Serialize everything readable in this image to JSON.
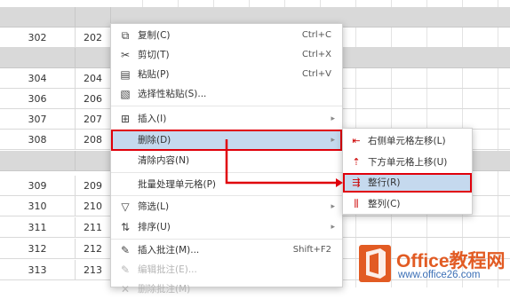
{
  "sheet": {
    "rows": [
      {
        "a": "",
        "b": "",
        "gray": true
      },
      {
        "a": "302",
        "b": "202",
        "gray": false
      },
      {
        "a": "",
        "b": "",
        "gray": true
      },
      {
        "a": "304",
        "b": "204",
        "gray": false
      },
      {
        "a": "306",
        "b": "206",
        "gray": false
      },
      {
        "a": "307",
        "b": "207",
        "gray": false
      },
      {
        "a": "308",
        "b": "208",
        "gray": false
      },
      {
        "a": "",
        "b": "",
        "gray": true
      },
      {
        "a": "309",
        "b": "209",
        "gray": false
      },
      {
        "a": "310",
        "b": "210",
        "gray": false
      },
      {
        "a": "311",
        "b": "211",
        "gray": false
      },
      {
        "a": "312",
        "b": "212",
        "gray": false
      },
      {
        "a": "313",
        "b": "213",
        "gray": false
      }
    ]
  },
  "context_menu": {
    "items": [
      {
        "label": "复制(C)",
        "shortcut": "Ctrl+C",
        "icon": "copy-icon"
      },
      {
        "label": "剪切(T)",
        "shortcut": "Ctrl+X",
        "icon": "cut-icon"
      },
      {
        "label": "粘贴(P)",
        "shortcut": "Ctrl+V",
        "icon": "paste-icon"
      },
      {
        "label": "选择性粘贴(S)...",
        "shortcut": "",
        "icon": "paste-special-icon"
      },
      {
        "label": "插入(I)",
        "shortcut": "",
        "icon": "insert-icon"
      },
      {
        "label": "删除(D)",
        "shortcut": "",
        "icon": ""
      },
      {
        "label": "清除内容(N)",
        "shortcut": "",
        "icon": ""
      },
      {
        "label": "批量处理单元格(P)",
        "shortcut": "",
        "icon": ""
      },
      {
        "label": "筛选(L)",
        "shortcut": "",
        "icon": "filter-icon"
      },
      {
        "label": "排序(U)",
        "shortcut": "",
        "icon": "sort-icon"
      },
      {
        "label": "插入批注(M)...",
        "shortcut": "Shift+F2",
        "icon": "comment-icon"
      },
      {
        "label": "编辑批注(E)...",
        "shortcut": "",
        "icon": "edit-comment-icon"
      },
      {
        "label": "删除批注(M)",
        "shortcut": "",
        "icon": "delete-comment-icon"
      }
    ]
  },
  "delete_submenu": {
    "items": [
      {
        "label": "右侧单元格左移(L)",
        "icon": "shift-left-icon"
      },
      {
        "label": "下方单元格上移(U)",
        "icon": "shift-up-icon"
      },
      {
        "label": "整行(R)",
        "icon": "entire-row-icon"
      },
      {
        "label": "整列(C)",
        "icon": "entire-column-icon"
      }
    ]
  },
  "watermark": {
    "title": "Office教程网",
    "url": "www.office26.com"
  },
  "colors": {
    "highlight_outline": "#e0000b",
    "highlight_fill": "#c5d9ee",
    "logo_orange": "#e25b23",
    "logo_blue": "#3b6fb6"
  }
}
